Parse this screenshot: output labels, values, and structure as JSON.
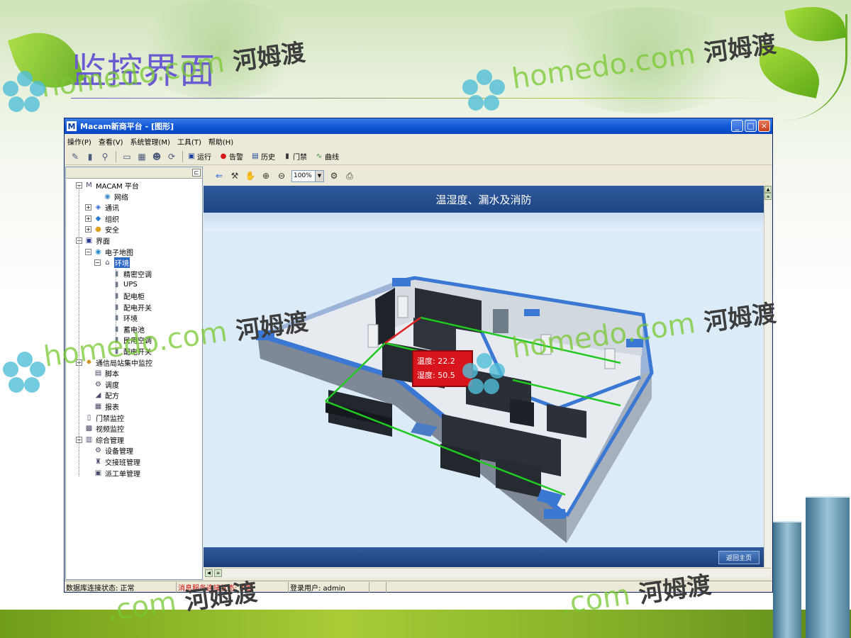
{
  "slide": {
    "title": "监控界面",
    "watermark_cn": "河姆渡",
    "watermark_en_dot": ".com",
    "watermark_en_word": "homedo"
  },
  "window": {
    "title": "Macam新商平台 - [图形]",
    "logo": "M",
    "controls": [
      "_",
      "□",
      "×"
    ]
  },
  "menu": [
    "操作(P)",
    "查看(V)",
    "系统管理(M)",
    "工具(T)",
    "帮助(H)"
  ],
  "toolbar": {
    "items": [
      {
        "label": "运行",
        "icon": "run-icon"
      },
      {
        "label": "告警",
        "icon": "alarm-icon"
      },
      {
        "label": "历史",
        "icon": "history-icon"
      },
      {
        "label": "门禁",
        "icon": "door-icon"
      },
      {
        "label": "曲线",
        "icon": "curve-icon"
      }
    ]
  },
  "tree": {
    "nodes": [
      {
        "label": "MACAM 平台",
        "icon": "platform-icon",
        "exp": "-"
      },
      {
        "label": "网络",
        "icon": "network-icon",
        "exp": ""
      },
      {
        "label": "通讯",
        "icon": "comm-icon",
        "exp": "+"
      },
      {
        "label": "组织",
        "icon": "org-icon",
        "exp": "+"
      },
      {
        "label": "安全",
        "icon": "security-icon",
        "exp": "+"
      },
      {
        "label": "界面",
        "icon": "monitor-icon",
        "exp": "-"
      },
      {
        "label": "电子地图",
        "icon": "globe-icon",
        "exp": "-"
      },
      {
        "label": "环境",
        "icon": "room-icon",
        "exp": "-"
      },
      {
        "label": "精密空调",
        "icon": "device-icon",
        "exp": ""
      },
      {
        "label": "UPS",
        "icon": "device-icon",
        "exp": ""
      },
      {
        "label": "配电柜",
        "icon": "device-icon",
        "exp": ""
      },
      {
        "label": "配电开关",
        "icon": "device-icon",
        "exp": ""
      },
      {
        "label": "环境",
        "icon": "device-icon",
        "exp": ""
      },
      {
        "label": "蓄电池",
        "icon": "device-icon",
        "exp": ""
      },
      {
        "label": "民用空调",
        "icon": "device-icon",
        "exp": ""
      },
      {
        "label": "配电开关",
        "icon": "device-icon",
        "exp": ""
      },
      {
        "label": "通信局站集中监控",
        "icon": "station-icon",
        "exp": "+"
      },
      {
        "label": "脚本",
        "icon": "script-icon",
        "exp": ""
      },
      {
        "label": "调度",
        "icon": "schedule-icon",
        "exp": ""
      },
      {
        "label": "配方",
        "icon": "recipe-icon",
        "exp": ""
      },
      {
        "label": "报表",
        "icon": "report-icon",
        "exp": ""
      },
      {
        "label": "门禁监控",
        "icon": "door-icon",
        "exp": ""
      },
      {
        "label": "视频监控",
        "icon": "video-icon",
        "exp": ""
      },
      {
        "label": "综合管理",
        "icon": "manage-icon",
        "exp": "-"
      },
      {
        "label": "设备管理",
        "icon": "gear-icon",
        "exp": ""
      },
      {
        "label": "交接班管理",
        "icon": "shift-icon",
        "exp": ""
      },
      {
        "label": "派工单管理",
        "icon": "order-icon",
        "exp": ""
      }
    ]
  },
  "view": {
    "zoom": "100%",
    "header_title": "温湿度、漏水及消防",
    "back_button": "返回主页"
  },
  "sensor": {
    "temp_label": "温度:",
    "temp_value": "22.2",
    "hum_label": "湿度:",
    "hum_value": "50.5"
  },
  "status": {
    "db": "数据库连接状态: 正常",
    "msg": "消息服务连接状态: 中断",
    "user": "登录用户: admin"
  },
  "colors": {
    "accent_title": "#6b5bd0",
    "header_blue": "#1e4584",
    "tooltip_red": "#d8141c",
    "wall_blue": "#3a78d4",
    "zone_green": "#22c822"
  }
}
